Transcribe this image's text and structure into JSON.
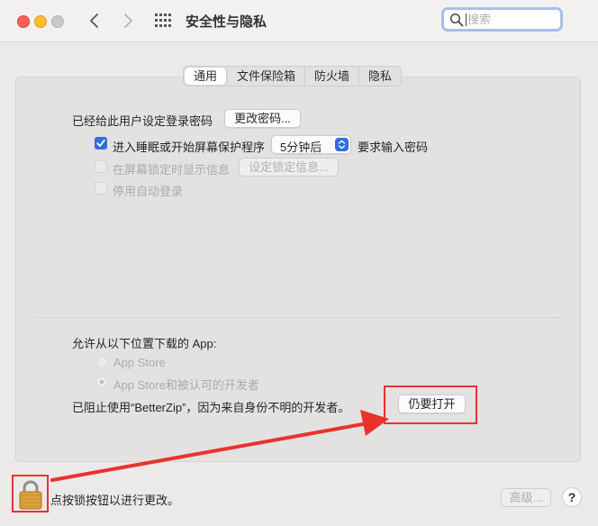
{
  "window": {
    "title": "安全性与隐私",
    "search_placeholder": "搜索"
  },
  "tabs": [
    {
      "label": "通用",
      "selected": true
    },
    {
      "label": "文件保险箱",
      "selected": false
    },
    {
      "label": "防火墙",
      "selected": false
    },
    {
      "label": "隐私",
      "selected": false
    }
  ],
  "general": {
    "password_label": "已经给此用户设定登录密码",
    "change_password_button": "更改密码...",
    "require_password_label": "进入睡眠或开始屏幕保护程序",
    "require_password_checked": true,
    "require_delay_value": "5分钟后",
    "require_password_suffix": "要求输入密码",
    "lock_message_label": "在屏幕锁定时显示信息",
    "lock_message_button": "设定锁定信息...",
    "disable_autologin_label": "停用自动登录"
  },
  "downloads": {
    "heading": "允许从以下位置下载的 App:",
    "options": [
      {
        "label": "App Store",
        "selected": false
      },
      {
        "label": "App Store和被认可的开发者",
        "selected": true
      }
    ],
    "blocked_message": "已阻止使用“BetterZip”，因为来自身份不明的开发者。",
    "open_anyway_button": "仍要打开"
  },
  "footer": {
    "lock_text": "点按锁按钮以进行更改。",
    "advanced_button": "高级...",
    "help_button": "?"
  },
  "colors": {
    "accent": "#2e6fdb",
    "annotation": "#e8332c"
  }
}
